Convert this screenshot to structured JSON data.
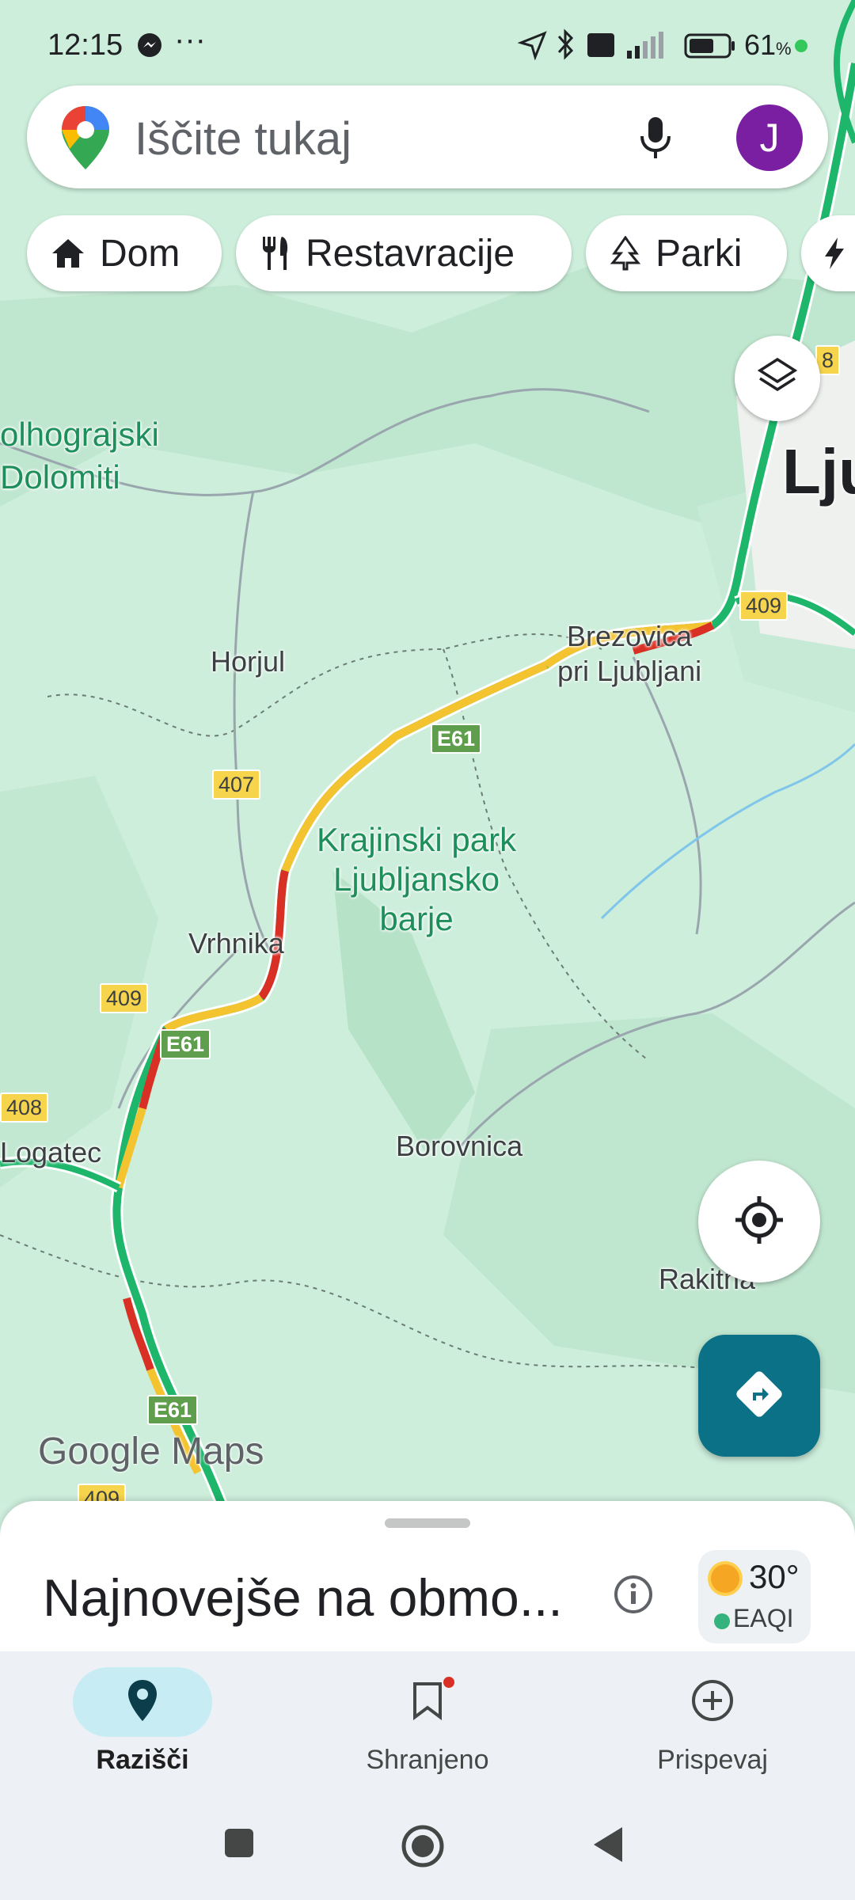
{
  "status_bar": {
    "time": "12:15",
    "overflow": "···",
    "battery_percent": "61",
    "battery_suffix": "%"
  },
  "search": {
    "placeholder": "Iščite tukaj",
    "avatar_letter": "J"
  },
  "chips": [
    {
      "label": "Dom",
      "icon": "home-icon"
    },
    {
      "label": "Restavracije",
      "icon": "restaurant-icon"
    },
    {
      "label": "Parki",
      "icon": "park-icon"
    },
    {
      "label": "",
      "icon": "bolt-icon"
    }
  ],
  "map": {
    "labels": {
      "dolomiti": "olhograjski\nDolomiti",
      "ljubljana": "Lju",
      "brezovica": "Brezovica\npri Ljubljani",
      "horjul": "Horjul",
      "park": "Krajinski park\nLjubljansko\nbarje",
      "vrhnika": "Vrhnika",
      "logatec": "Logatec",
      "borovnica": "Borovnica",
      "rakitna": "Rakitna"
    },
    "shields": {
      "r8": "8",
      "r409a": "409",
      "e61a": "E61",
      "r407": "407",
      "r409b": "409",
      "e61b": "E61",
      "r408": "408",
      "e61c": "E61",
      "r409c": "409"
    },
    "attribution": "Google Maps"
  },
  "sheet": {
    "title": "Najnovejše na obmo...",
    "temperature": "30°",
    "air_quality_label": "EAQI"
  },
  "nav": [
    {
      "label": "Razišči",
      "icon": "explore-pin-icon",
      "active": true
    },
    {
      "label": "Shranjeno",
      "icon": "bookmark-icon",
      "active": false
    },
    {
      "label": "Prispevaj",
      "icon": "add-circle-icon",
      "active": false
    }
  ],
  "colors": {
    "map_bg": "#cfeedd",
    "accent_teal": "#0b7187",
    "avatar": "#7b1fa2",
    "traffic_green": "#1db66b",
    "traffic_yellow": "#f4c430",
    "traffic_red": "#d93025"
  }
}
